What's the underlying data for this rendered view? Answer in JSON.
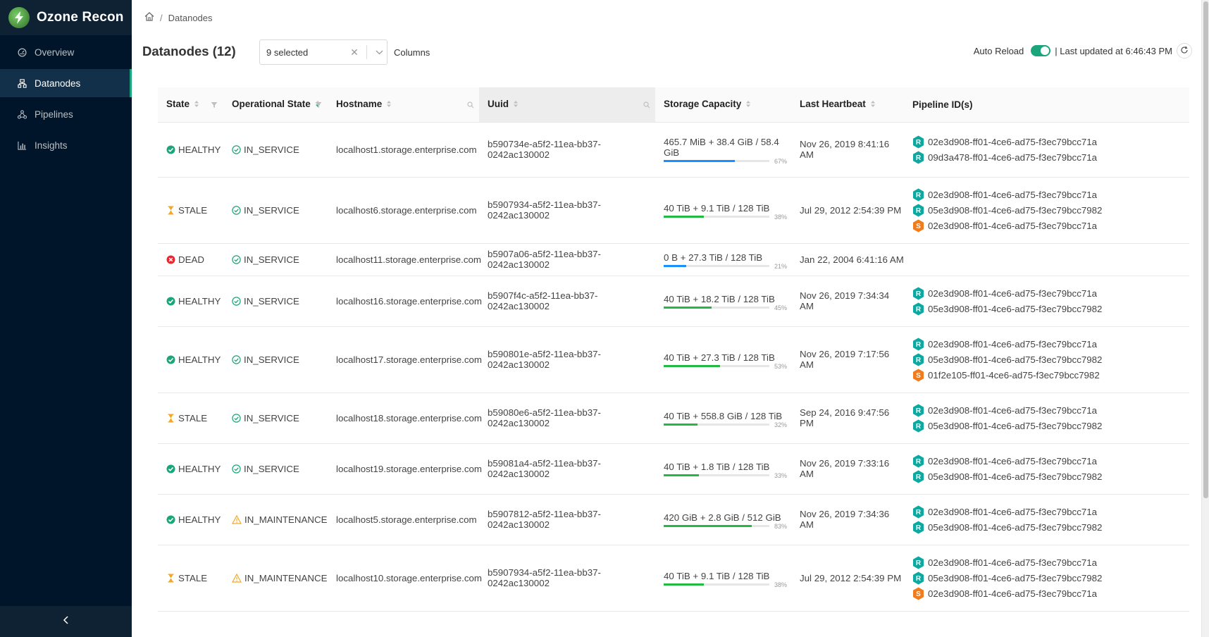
{
  "app": {
    "name": "Ozone Recon"
  },
  "sidebar": {
    "items": [
      {
        "label": "Overview",
        "icon": "dashboard-icon",
        "active": false
      },
      {
        "label": "Datanodes",
        "icon": "cluster-icon",
        "active": true
      },
      {
        "label": "Pipelines",
        "icon": "deployment-unit-icon",
        "active": false
      },
      {
        "label": "Insights",
        "icon": "bar-chart-icon",
        "active": false
      }
    ],
    "collapse_icon": "chevron-left-icon"
  },
  "breadcrumb": {
    "home_icon": "home-icon",
    "separator": "/",
    "current": "Datanodes"
  },
  "header": {
    "title": "Datanodes (12)",
    "columns_select_value": "9 selected",
    "columns_label": "Columns",
    "auto_reload_label": "Auto Reload",
    "auto_reload_on": true,
    "last_updated": "| Last updated at 6:46:43 PM"
  },
  "colors": {
    "accent": "#1aa57a",
    "healthy": "#1aa57a",
    "stale": "#f5a623",
    "dead": "#f5222d",
    "maintenance": "#f5a623",
    "ratis": "#0fa8a0",
    "standalone": "#f07c1f",
    "bar_green": "#23b943",
    "bar_blue": "#1890ff"
  },
  "table": {
    "columns": [
      "State",
      "Operational State",
      "Hostname",
      "Uuid",
      "Storage Capacity",
      "Last Heartbeat",
      "Pipeline ID(s)"
    ],
    "rows": [
      {
        "state": "HEALTHY",
        "op_state": "IN_SERVICE",
        "hostname": "localhost1.storage.enterprise.com",
        "uuid": "b590734e-a5f2-11ea-bb37-0242ac130002",
        "capacity": "465.7 MiB + 38.4 GiB / 58.4 GiB",
        "used_pct": 67,
        "bar_color": "blue",
        "pct_label": "67%",
        "heartbeat": "Nov 26, 2019 8:41:16 AM",
        "pipelines": [
          {
            "type": "R",
            "id": "02e3d908-ff01-4ce6-ad75-f3ec79bcc71a"
          },
          {
            "type": "R",
            "id": "09d3a478-ff01-4ce6-ad75-f3ec79bcc71a"
          }
        ]
      },
      {
        "state": "STALE",
        "op_state": "IN_SERVICE",
        "hostname": "localhost6.storage.enterprise.com",
        "uuid": "b5907934-a5f2-11ea-bb37-0242ac130002",
        "capacity": "40 TiB + 9.1 TiB / 128 TiB",
        "used_pct": 38,
        "bar_color": "green",
        "pct_label": "38%",
        "heartbeat": "Jul 29, 2012 2:54:39 PM",
        "pipelines": [
          {
            "type": "R",
            "id": "02e3d908-ff01-4ce6-ad75-f3ec79bcc71a"
          },
          {
            "type": "R",
            "id": "05e3d908-ff01-4ce6-ad75-f3ec79bcc7982"
          },
          {
            "type": "S",
            "id": "02e3d908-ff01-4ce6-ad75-f3ec79bcc71a"
          }
        ]
      },
      {
        "state": "DEAD",
        "op_state": "IN_SERVICE",
        "hostname": "localhost11.storage.enterprise.com",
        "uuid": "b5907a06-a5f2-11ea-bb37-0242ac130002",
        "capacity": "0 B + 27.3 TiB / 128 TiB",
        "used_pct": 21,
        "bar_color": "blue",
        "pct_label": "21%",
        "heartbeat": "Jan 22, 2004 6:41:16 AM",
        "pipelines": []
      },
      {
        "state": "HEALTHY",
        "op_state": "IN_SERVICE",
        "hostname": "localhost16.storage.enterprise.com",
        "uuid": "b5907f4c-a5f2-11ea-bb37-0242ac130002",
        "capacity": "40 TiB + 18.2 TiB / 128 TiB",
        "used_pct": 45,
        "bar_color": "green",
        "pct_label": "45%",
        "heartbeat": "Nov 26, 2019 7:34:34 AM",
        "pipelines": [
          {
            "type": "R",
            "id": "02e3d908-ff01-4ce6-ad75-f3ec79bcc71a"
          },
          {
            "type": "R",
            "id": "05e3d908-ff01-4ce6-ad75-f3ec79bcc7982"
          }
        ]
      },
      {
        "state": "HEALTHY",
        "op_state": "IN_SERVICE",
        "hostname": "localhost17.storage.enterprise.com",
        "uuid": "b590801e-a5f2-11ea-bb37-0242ac130002",
        "capacity": "40 TiB + 27.3 TiB / 128 TiB",
        "used_pct": 53,
        "bar_color": "green",
        "pct_label": "53%",
        "heartbeat": "Nov 26, 2019 7:17:56 AM",
        "pipelines": [
          {
            "type": "R",
            "id": "02e3d908-ff01-4ce6-ad75-f3ec79bcc71a"
          },
          {
            "type": "R",
            "id": "05e3d908-ff01-4ce6-ad75-f3ec79bcc7982"
          },
          {
            "type": "S",
            "id": "01f2e105-ff01-4ce6-ad75-f3ec79bcc7982"
          }
        ]
      },
      {
        "state": "STALE",
        "op_state": "IN_SERVICE",
        "hostname": "localhost18.storage.enterprise.com",
        "uuid": "b59080e6-a5f2-11ea-bb37-0242ac130002",
        "capacity": "40 TiB + 558.8 GiB / 128 TiB",
        "used_pct": 32,
        "bar_color": "green",
        "pct_label": "32%",
        "heartbeat": "Sep 24, 2016 9:47:56 PM",
        "pipelines": [
          {
            "type": "R",
            "id": "02e3d908-ff01-4ce6-ad75-f3ec79bcc71a"
          },
          {
            "type": "R",
            "id": "05e3d908-ff01-4ce6-ad75-f3ec79bcc7982"
          }
        ]
      },
      {
        "state": "HEALTHY",
        "op_state": "IN_SERVICE",
        "hostname": "localhost19.storage.enterprise.com",
        "uuid": "b59081a4-a5f2-11ea-bb37-0242ac130002",
        "capacity": "40 TiB + 1.8 TiB / 128 TiB",
        "used_pct": 33,
        "bar_color": "green",
        "pct_label": "33%",
        "heartbeat": "Nov 26, 2019 7:33:16 AM",
        "pipelines": [
          {
            "type": "R",
            "id": "02e3d908-ff01-4ce6-ad75-f3ec79bcc71a"
          },
          {
            "type": "R",
            "id": "05e3d908-ff01-4ce6-ad75-f3ec79bcc7982"
          }
        ]
      },
      {
        "state": "HEALTHY",
        "op_state": "IN_MAINTENANCE",
        "hostname": "localhost5.storage.enterprise.com",
        "uuid": "b5907812-a5f2-11ea-bb37-0242ac130002",
        "capacity": "420 GiB + 2.8 GiB / 512 GiB",
        "used_pct": 83,
        "bar_color": "green",
        "pct_label": "83%",
        "heartbeat": "Nov 26, 2019 7:34:36 AM",
        "pipelines": [
          {
            "type": "R",
            "id": "02e3d908-ff01-4ce6-ad75-f3ec79bcc71a"
          },
          {
            "type": "R",
            "id": "05e3d908-ff01-4ce6-ad75-f3ec79bcc7982"
          }
        ]
      },
      {
        "state": "STALE",
        "op_state": "IN_MAINTENANCE",
        "hostname": "localhost10.storage.enterprise.com",
        "uuid": "b5907934-a5f2-11ea-bb37-0242ac130002",
        "capacity": "40 TiB + 9.1 TiB / 128 TiB",
        "used_pct": 38,
        "bar_color": "green",
        "pct_label": "38%",
        "heartbeat": "Jul 29, 2012 2:54:39 PM",
        "pipelines": [
          {
            "type": "R",
            "id": "02e3d908-ff01-4ce6-ad75-f3ec79bcc71a"
          },
          {
            "type": "R",
            "id": "05e3d908-ff01-4ce6-ad75-f3ec79bcc7982"
          },
          {
            "type": "S",
            "id": "02e3d908-ff01-4ce6-ad75-f3ec79bcc71a"
          }
        ]
      }
    ]
  }
}
